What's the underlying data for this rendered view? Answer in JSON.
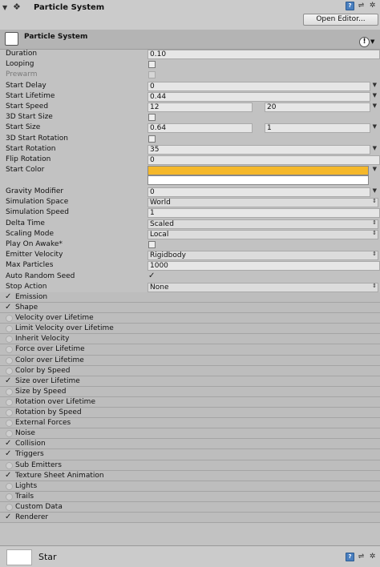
{
  "header": {
    "title": "Particle System",
    "open_editor": "Open Editor..."
  },
  "component": {
    "label": "Particle System"
  },
  "properties": {
    "duration": {
      "label": "Duration",
      "value": "0.10"
    },
    "looping": {
      "label": "Looping"
    },
    "prewarm": {
      "label": "Prewarm"
    },
    "start_delay": {
      "label": "Start Delay",
      "value": "0"
    },
    "start_lifetime": {
      "label": "Start Lifetime",
      "value": "0.44"
    },
    "start_speed": {
      "label": "Start Speed",
      "min": "12",
      "max": "20"
    },
    "start_size_3d": {
      "label": "3D Start Size"
    },
    "start_size": {
      "label": "Start Size",
      "min": "0.64",
      "max": "1"
    },
    "start_rotation_3d": {
      "label": "3D Start Rotation"
    },
    "start_rotation": {
      "label": "Start Rotation",
      "value": "35"
    },
    "flip_rotation": {
      "label": "Flip Rotation",
      "value": "0"
    },
    "start_color": {
      "label": "Start Color",
      "color_a": "#f5b82a",
      "color_b": "#ffffff"
    },
    "gravity_modifier": {
      "label": "Gravity Modifier",
      "value": "0"
    },
    "simulation_space": {
      "label": "Simulation Space",
      "value": "World"
    },
    "simulation_speed": {
      "label": "Simulation Speed",
      "value": "1"
    },
    "delta_time": {
      "label": "Delta Time",
      "value": "Scaled"
    },
    "scaling_mode": {
      "label": "Scaling Mode",
      "value": "Local"
    },
    "play_on_awake": {
      "label": "Play On Awake*"
    },
    "emitter_velocity": {
      "label": "Emitter Velocity",
      "value": "Rigidbody"
    },
    "max_particles": {
      "label": "Max Particles",
      "value": "1000"
    },
    "auto_random_seed": {
      "label": "Auto Random Seed"
    },
    "stop_action": {
      "label": "Stop Action",
      "value": "None"
    }
  },
  "modules": [
    {
      "label": "Emission",
      "enabled": true
    },
    {
      "label": "Shape",
      "enabled": true
    },
    {
      "label": "Velocity over Lifetime",
      "enabled": false
    },
    {
      "label": "Limit Velocity over Lifetime",
      "enabled": false
    },
    {
      "label": "Inherit Velocity",
      "enabled": false
    },
    {
      "label": "Force over Lifetime",
      "enabled": false
    },
    {
      "label": "Color over Lifetime",
      "enabled": false
    },
    {
      "label": "Color by Speed",
      "enabled": false
    },
    {
      "label": "Size over Lifetime",
      "enabled": true
    },
    {
      "label": "Size by Speed",
      "enabled": false
    },
    {
      "label": "Rotation over Lifetime",
      "enabled": false
    },
    {
      "label": "Rotation by Speed",
      "enabled": false
    },
    {
      "label": "External Forces",
      "enabled": false
    },
    {
      "label": "Noise",
      "enabled": false
    },
    {
      "label": "Collision",
      "enabled": true
    },
    {
      "label": "Triggers",
      "enabled": true
    },
    {
      "label": "Sub Emitters",
      "enabled": false
    },
    {
      "label": "Texture Sheet Animation",
      "enabled": true
    },
    {
      "label": "Lights",
      "enabled": false
    },
    {
      "label": "Trails",
      "enabled": false
    },
    {
      "label": "Custom Data",
      "enabled": false
    },
    {
      "label": "Renderer",
      "enabled": true
    }
  ],
  "footer": {
    "material_name": "Star"
  },
  "icons": {
    "header": [
      "help-icon",
      "settings-icon",
      "gear-icon"
    ],
    "footer": [
      "help-icon",
      "settings-icon",
      "gear-icon"
    ]
  }
}
